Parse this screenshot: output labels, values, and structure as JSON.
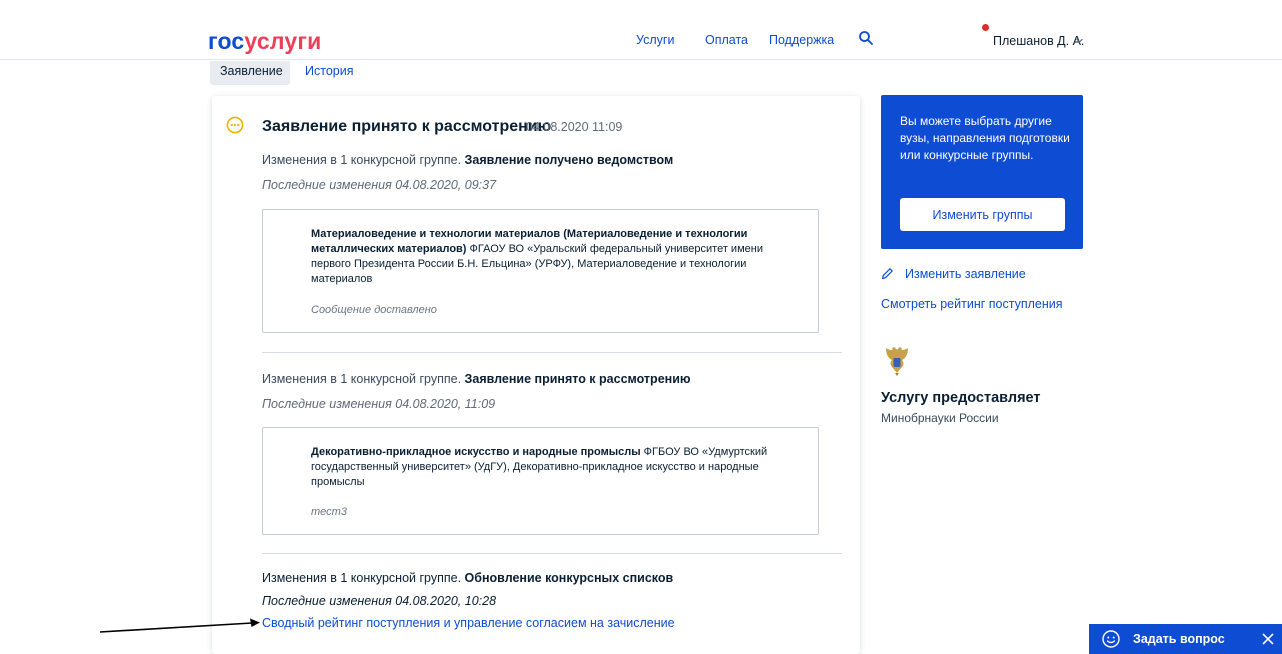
{
  "header": {
    "logo_part1": "гос",
    "logo_part2": "услуги",
    "nav": {
      "services": "Услуги",
      "payment": "Оплата",
      "support": "Поддержка"
    },
    "user_name": "Плешанов Д. А."
  },
  "tabs": {
    "statement": "Заявление",
    "history": "История"
  },
  "status": {
    "title": "Заявление принято к рассмотрению",
    "datetime": "04.08.2020 11:09"
  },
  "events": [
    {
      "prefix": "Изменения в 1 конкурсной группе. ",
      "bold": "Заявление получено ведомством",
      "last_change": "Последние изменения 04.08.2020, 09:37",
      "box_bold": "Материаловедение и технологии материалов (Материаловедение и технологии металлических материалов)",
      "box_text": " ФГАОУ ВО «Уральский федеральный университет имени первого Президента России Б.Н. Ельцина» (УРФУ), Материаловедение и технологии материалов",
      "box_note": "Сообщение доставлено"
    },
    {
      "prefix": "Изменения в 1 конкурсной группе. ",
      "bold": "Заявление принято к рассмотрению",
      "last_change": "Последние изменения 04.08.2020, 11:09",
      "box_bold": "Декоративно-прикладное искусство и народные промыслы",
      "box_text": " ФГБОУ ВО «Удмуртский государственный университет» (УдГУ), Декоративно-прикладное искусство и народные промыслы",
      "box_note": "тест3"
    },
    {
      "prefix": "Изменения в 1 конкурсной группе. ",
      "bold": "Обновление конкурсных списков",
      "last_change": "Последние изменения 04.08.2020, 10:28",
      "link": "Сводный рейтинг поступления и управление согласием на зачисление"
    }
  ],
  "sidebar": {
    "promo_text": "Вы можете выбрать другие вузы, направления подготовки или конкурсные группы.",
    "promo_button": "Изменить группы",
    "edit_statement": "Изменить заявление",
    "view_rating": "Смотреть рейтинг поступления",
    "provider_title": "Услугу предоставляет",
    "provider_name": "Минобрнауки России"
  },
  "ask": {
    "label": "Задать вопрос"
  },
  "colors": {
    "brand_blue": "#0d4cd3",
    "brand_red": "#ee3f58",
    "status_yellow": "#f0b400",
    "text_dark": "#0b1f33"
  },
  "icons": [
    "search-icon",
    "chevron-down-icon",
    "status-pending-icon",
    "pencil-icon",
    "emblem-icon",
    "support-bot-icon",
    "close-icon"
  ]
}
